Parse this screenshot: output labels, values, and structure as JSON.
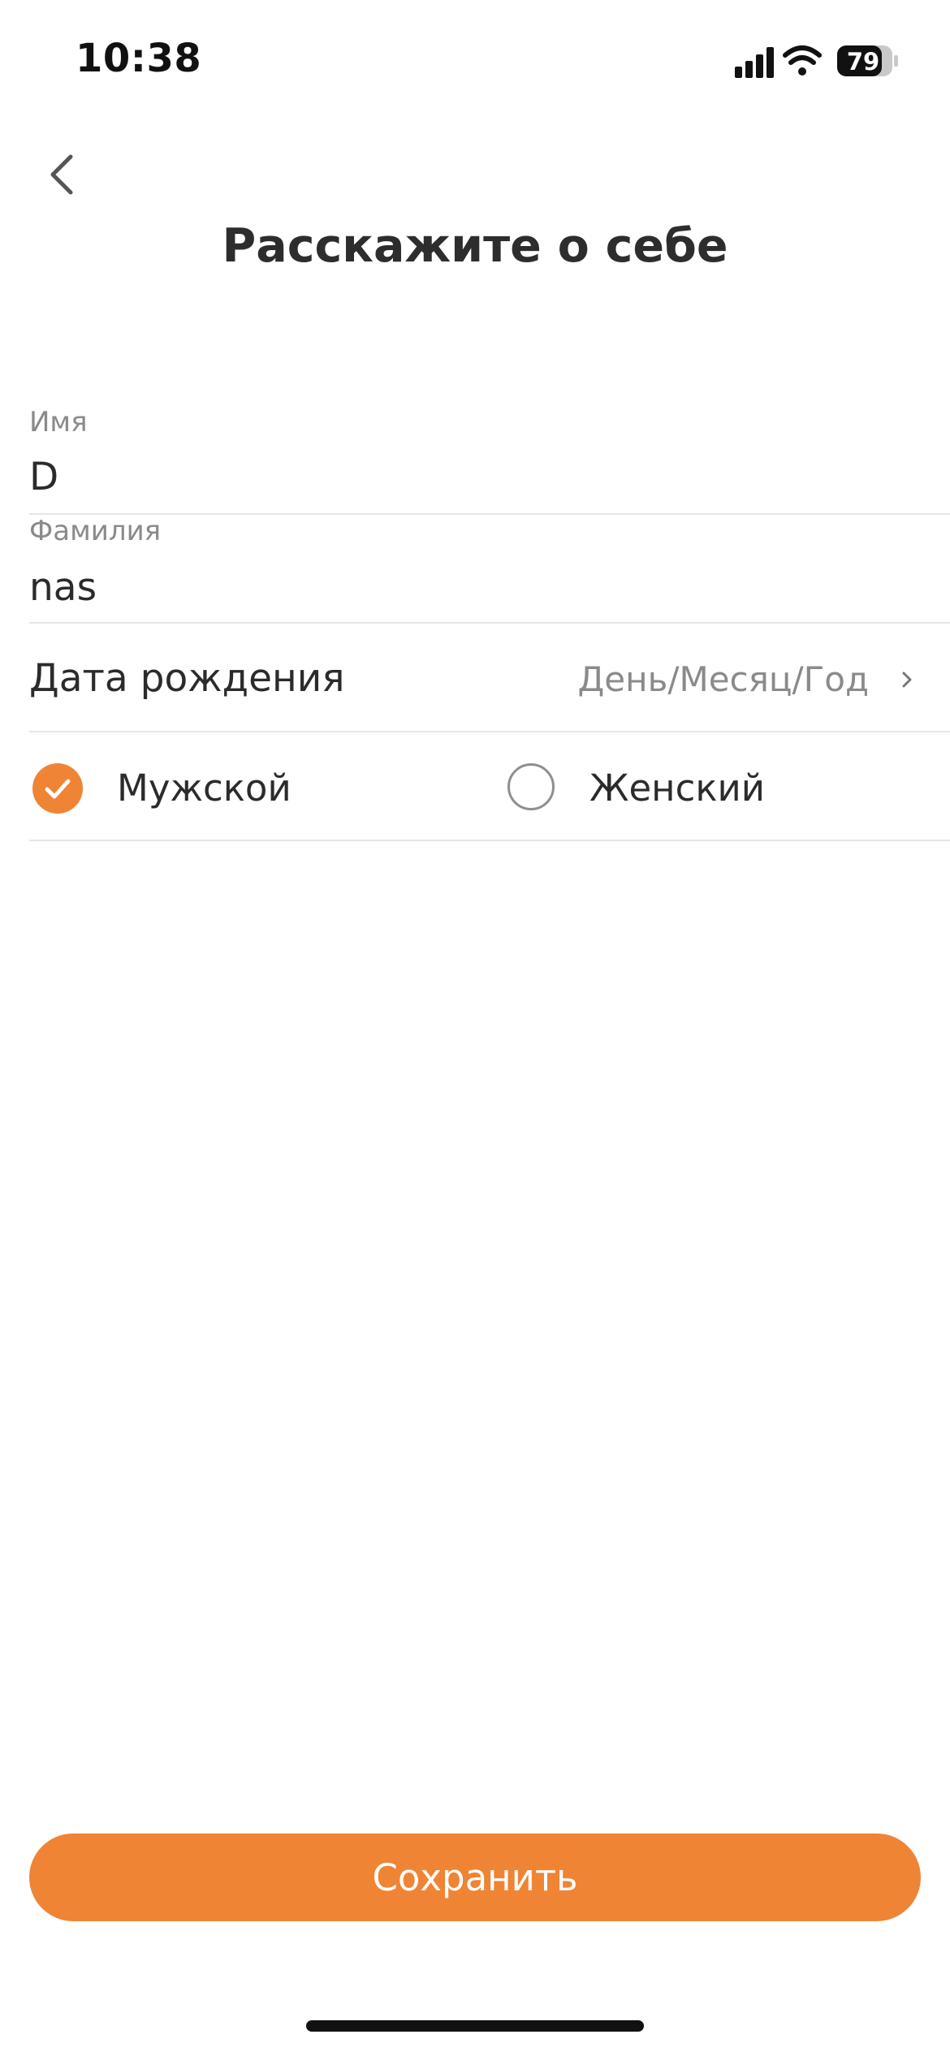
{
  "status_bar": {
    "time": "10:38",
    "battery": "79",
    "icons": [
      "signal-icon",
      "wifi-icon",
      "battery-icon"
    ]
  },
  "header": {
    "back_icon": "chevron-left-icon",
    "title": "Расскажите о себе"
  },
  "form": {
    "first_name": {
      "label": "Имя",
      "value": "D"
    },
    "last_name": {
      "label": "Фамилия",
      "value": "nas"
    },
    "birth_date": {
      "label": "Дата рождения",
      "placeholder": "День/Месяц/Год",
      "icon": "chevron-right-icon"
    },
    "gender": {
      "options": [
        {
          "label": "Мужской",
          "selected": true
        },
        {
          "label": "Женский",
          "selected": false
        }
      ]
    }
  },
  "save_label": "Сохранить",
  "colors": {
    "accent": "#ef8435",
    "text": "#2b2b2b",
    "muted": "#8a8a8a",
    "divider": "#e6e6e6"
  }
}
